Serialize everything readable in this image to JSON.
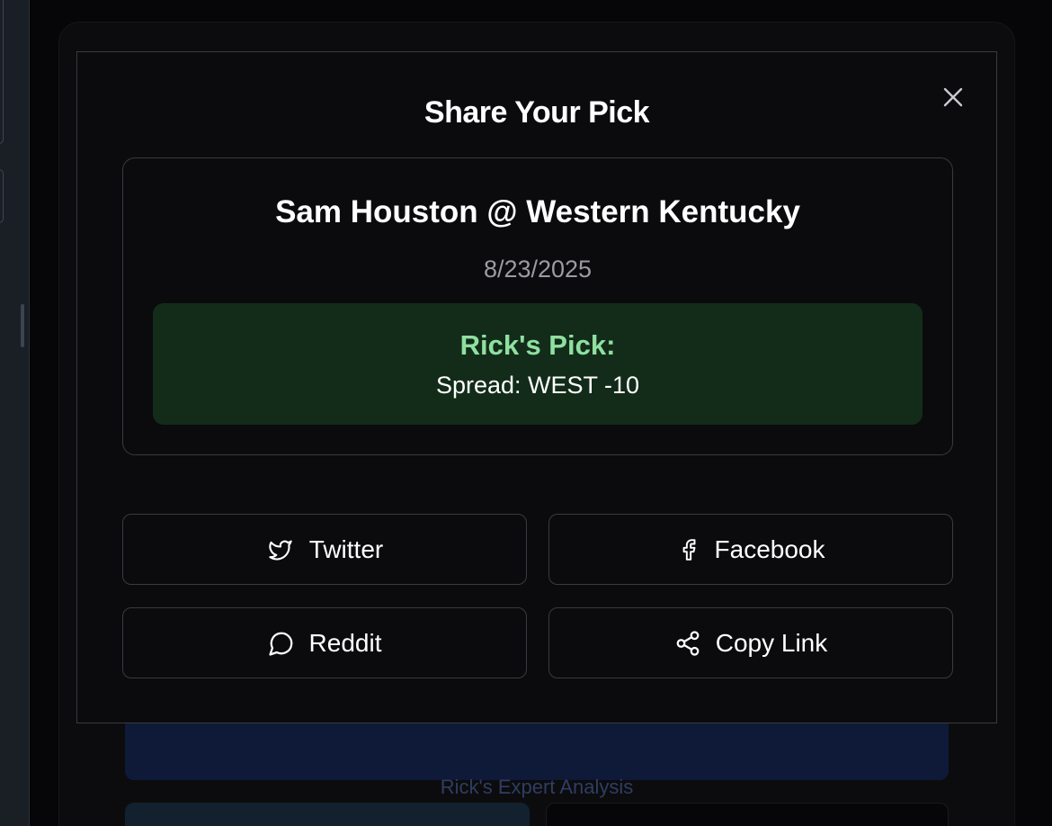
{
  "background": {
    "analysis_button": "Rick's Expert Analysis"
  },
  "modal": {
    "title": "Share Your Pick",
    "close_icon": "close-icon",
    "pick": {
      "matchup": "Sam Houston @ Western Kentucky",
      "date": "8/23/2025",
      "label": "Rick's Pick:",
      "value": "Spread: WEST -10"
    },
    "share_buttons": {
      "twitter": {
        "label": "Twitter",
        "icon": "twitter-icon"
      },
      "facebook": {
        "label": "Facebook",
        "icon": "facebook-icon"
      },
      "reddit": {
        "label": "Reddit",
        "icon": "message-circle-icon"
      },
      "copy_link": {
        "label": "Copy Link",
        "icon": "share-icon"
      }
    }
  },
  "colors": {
    "modal_bg": "#0b0b0d",
    "border": "#3a3a3f",
    "pick_box_bg": "#132c1a",
    "pick_label": "#8fe0a0",
    "muted_text": "#9b9ba3",
    "analysis_bg": "#0e1a38"
  }
}
